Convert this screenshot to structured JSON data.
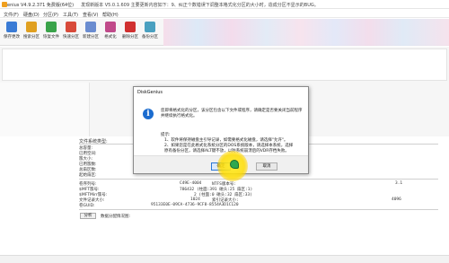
{
  "window": {
    "title": "enius V4.9.2.371 免费版(64位)",
    "notice": "发现新版本 V5.0.1.609 主要更新内容如下：9、纠正个数错误下调整本格式化分区的大小时，造成分区不显示的BUG。"
  },
  "menu": {
    "items": [
      "文件(F)",
      "硬盘(D)",
      "分区(P)",
      "工具(T)",
      "查看(V)",
      "帮助(H)"
    ]
  },
  "toolbar": {
    "items": [
      {
        "label": "保存更改",
        "icon": "save-icon",
        "color": "#3a7bd5"
      },
      {
        "label": "搜索分区",
        "icon": "search-partition-icon",
        "color": "#e0a020"
      },
      {
        "label": "恢复文件",
        "icon": "recover-file-icon",
        "color": "#3aa34a"
      },
      {
        "label": "快速分区",
        "icon": "quick-partition-icon",
        "color": "#d84a3a"
      },
      {
        "label": "新建分区",
        "icon": "new-partition-icon",
        "color": "#6a8cd0"
      },
      {
        "label": "格式化",
        "icon": "format-icon",
        "color": "#c04a8a"
      },
      {
        "label": "删除分区",
        "icon": "delete-partition-icon",
        "color": "#d03030"
      },
      {
        "label": "备份分区",
        "icon": "backup-partition-icon",
        "color": "#4aa0c0"
      }
    ]
  },
  "info": {
    "section_title": "文件系统类型:",
    "labels": [
      "总容量:",
      "已用空间:",
      "簇大小:",
      "已用簇数:",
      "总扇区数:",
      "起始扇区:"
    ],
    "rows": [
      {
        "label": "卷序列号:",
        "value": "C49E-4004",
        "extra": "NTFS版本号:",
        "extra_val": "3.1"
      },
      {
        "label": "$MFT簇号:",
        "value": "786432 (柱面:391 磁头:25 扇区:1)"
      },
      {
        "label": "$MFTMirr簇号:",
        "value": "2 (柱面:0 磁头:32 扇区:33)"
      },
      {
        "label": "文件记录大小:",
        "value": "1024",
        "extra": "索引记录大小:",
        "extra_val": "4096"
      },
      {
        "label": "卷GUID:",
        "value": "95133E0E-09CA-4736-9CF8-8554A3D1C120"
      }
    ],
    "analyze_label": "分析",
    "map_label": "数据分配情况图:"
  },
  "dialog": {
    "title": "DiskGenius",
    "message": "您即将格式化的分区，该分区包含以下文件或程序，请确定是否要关闭当前程序并继续执行格式化。",
    "hint_title": "提示:",
    "hints": [
      "1、软件将保持磁盘主引导记录，如需要格式化磁盘，请选择\"允许\"。",
      "2、如果您是在此格式化系统分区的DOS系统版本，请选择本系统，选择",
      "   原有备份分区，请选择ALT键不放，以防系统崩溃后的VDR存档失败。"
    ],
    "ok_label": "确定",
    "cancel_label": "取消"
  }
}
